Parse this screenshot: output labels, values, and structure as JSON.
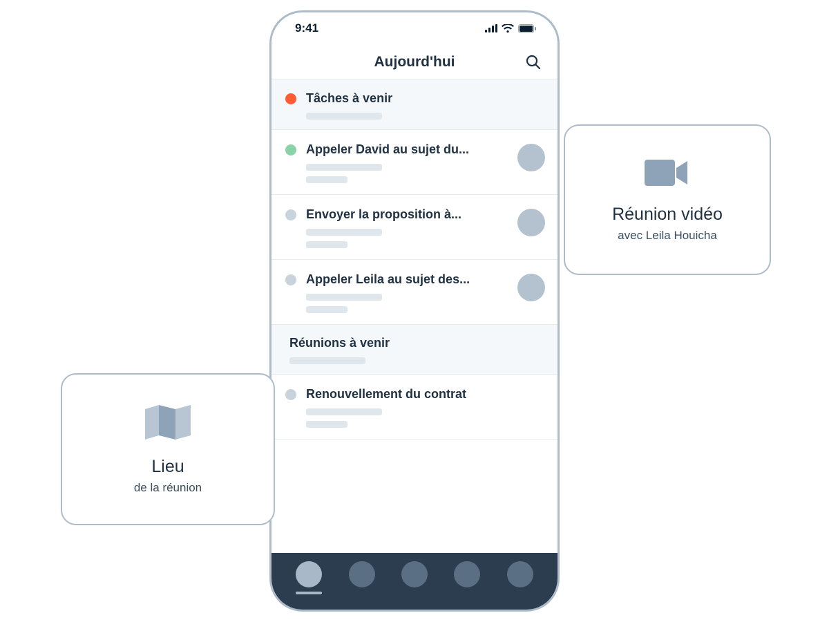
{
  "status": {
    "time": "9:41"
  },
  "header": {
    "title": "Aujourd'hui"
  },
  "sections": {
    "tasks": {
      "header": "Tâches à venir",
      "items": [
        "Appeler David au sujet du...",
        "Envoyer la proposition à...",
        "Appeler Leila au sujet des..."
      ]
    },
    "meetings": {
      "header": "Réunions à venir",
      "items": [
        "Renouvellement du contrat"
      ]
    }
  },
  "cards": {
    "video": {
      "title": "Réunion vidéo",
      "sub": "avec Leila Houicha"
    },
    "location": {
      "title": "Lieu",
      "sub": "de la réunion"
    }
  }
}
